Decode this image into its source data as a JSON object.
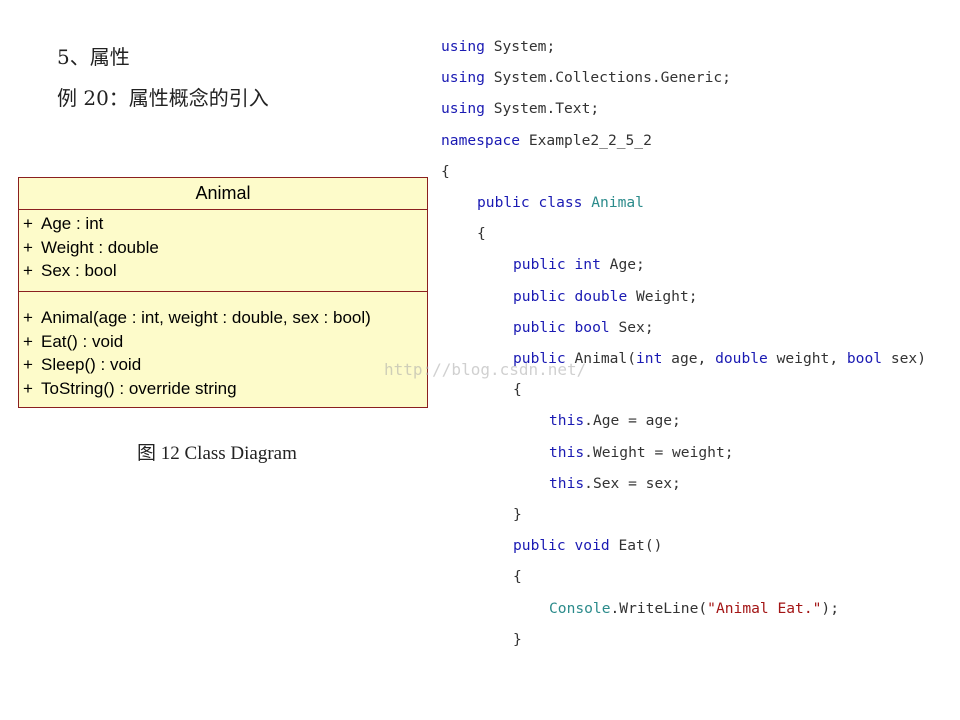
{
  "headings": {
    "section": "5、属性",
    "example": "例 20：属性概念的引入"
  },
  "uml": {
    "class_name": "Animal",
    "attributes": [
      {
        "visibility": "+",
        "text": "Age : int"
      },
      {
        "visibility": "+",
        "text": "Weight : double"
      },
      {
        "visibility": "+",
        "text": "Sex : bool"
      }
    ],
    "operations": [
      {
        "visibility": "+",
        "text": "Animal(age : int, weight : double, sex : bool)"
      },
      {
        "visibility": "+",
        "text": "Eat() : void"
      },
      {
        "visibility": "+",
        "text": "Sleep() : void"
      },
      {
        "visibility": "+",
        "text": "ToString() : override string"
      }
    ]
  },
  "caption": "图 12 Class Diagram",
  "watermark": "http://blog.csdn.net/",
  "colors": {
    "keyword": "#1a1ab3",
    "type": "#2b8b8b",
    "string": "#a31515",
    "uml_fill": "#fdfbca",
    "uml_border": "#8a1f1f"
  },
  "code": [
    {
      "indent": 0,
      "tokens": [
        {
          "t": "kw",
          "v": "using"
        },
        {
          "t": "plain",
          "v": " System;"
        }
      ]
    },
    {
      "indent": 0,
      "tokens": [
        {
          "t": "kw",
          "v": "using"
        },
        {
          "t": "plain",
          "v": " System.Collections.Generic;"
        }
      ]
    },
    {
      "indent": 0,
      "tokens": [
        {
          "t": "kw",
          "v": "using"
        },
        {
          "t": "plain",
          "v": " System.Text;"
        }
      ]
    },
    {
      "indent": 0,
      "tokens": [
        {
          "t": "kw",
          "v": "namespace"
        },
        {
          "t": "plain",
          "v": " Example2_2_5_2"
        }
      ]
    },
    {
      "indent": 0,
      "tokens": [
        {
          "t": "plain",
          "v": "{"
        }
      ]
    },
    {
      "indent": 1,
      "tokens": [
        {
          "t": "kw",
          "v": "public"
        },
        {
          "t": "plain",
          "v": " "
        },
        {
          "t": "kw",
          "v": "class"
        },
        {
          "t": "plain",
          "v": " "
        },
        {
          "t": "type",
          "v": "Animal"
        }
      ]
    },
    {
      "indent": 1,
      "tokens": [
        {
          "t": "plain",
          "v": "{"
        }
      ]
    },
    {
      "indent": 2,
      "tokens": [
        {
          "t": "kw",
          "v": "public"
        },
        {
          "t": "plain",
          "v": " "
        },
        {
          "t": "kw",
          "v": "int"
        },
        {
          "t": "plain",
          "v": " Age;"
        }
      ]
    },
    {
      "indent": 2,
      "tokens": [
        {
          "t": "kw",
          "v": "public"
        },
        {
          "t": "plain",
          "v": " "
        },
        {
          "t": "kw",
          "v": "double"
        },
        {
          "t": "plain",
          "v": " Weight;"
        }
      ]
    },
    {
      "indent": 2,
      "tokens": [
        {
          "t": "kw",
          "v": "public"
        },
        {
          "t": "plain",
          "v": " "
        },
        {
          "t": "kw",
          "v": "bool"
        },
        {
          "t": "plain",
          "v": " Sex;"
        }
      ]
    },
    {
      "indent": 2,
      "tokens": [
        {
          "t": "kw",
          "v": "public"
        },
        {
          "t": "plain",
          "v": " Animal("
        },
        {
          "t": "kw",
          "v": "int"
        },
        {
          "t": "plain",
          "v": " age, "
        },
        {
          "t": "kw",
          "v": "double"
        },
        {
          "t": "plain",
          "v": " weight, "
        },
        {
          "t": "kw",
          "v": "bool"
        },
        {
          "t": "plain",
          "v": " sex)"
        }
      ]
    },
    {
      "indent": 2,
      "tokens": [
        {
          "t": "plain",
          "v": "{"
        }
      ]
    },
    {
      "indent": 3,
      "tokens": [
        {
          "t": "kw",
          "v": "this"
        },
        {
          "t": "plain",
          "v": ".Age = age;"
        }
      ]
    },
    {
      "indent": 3,
      "tokens": [
        {
          "t": "kw",
          "v": "this"
        },
        {
          "t": "plain",
          "v": ".Weight = weight;"
        }
      ]
    },
    {
      "indent": 3,
      "tokens": [
        {
          "t": "kw",
          "v": "this"
        },
        {
          "t": "plain",
          "v": ".Sex = sex;"
        }
      ]
    },
    {
      "indent": 2,
      "tokens": [
        {
          "t": "plain",
          "v": "}"
        }
      ]
    },
    {
      "indent": 2,
      "tokens": [
        {
          "t": "kw",
          "v": "public"
        },
        {
          "t": "plain",
          "v": " "
        },
        {
          "t": "kw",
          "v": "void"
        },
        {
          "t": "plain",
          "v": " Eat()"
        }
      ]
    },
    {
      "indent": 2,
      "tokens": [
        {
          "t": "plain",
          "v": "{"
        }
      ]
    },
    {
      "indent": 3,
      "tokens": [
        {
          "t": "type",
          "v": "Console"
        },
        {
          "t": "plain",
          "v": ".WriteLine("
        },
        {
          "t": "str",
          "v": "\"Animal Eat.\""
        },
        {
          "t": "plain",
          "v": ");"
        }
      ]
    },
    {
      "indent": 2,
      "tokens": [
        {
          "t": "plain",
          "v": "}"
        }
      ]
    }
  ]
}
